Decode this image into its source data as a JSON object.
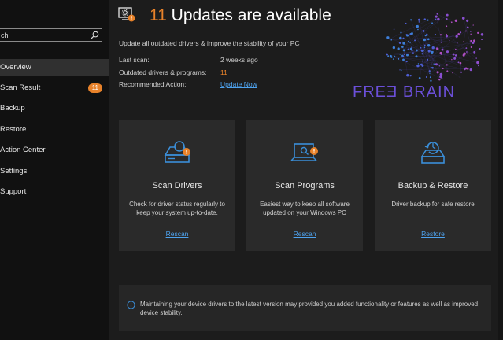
{
  "sidebar": {
    "search_value": "ch",
    "items": [
      {
        "label": "Overview",
        "active": true
      },
      {
        "label": "Scan Result",
        "badge": "11"
      },
      {
        "label": "Backup"
      },
      {
        "label": "Restore"
      },
      {
        "label": "Action Center"
      },
      {
        "label": "Settings"
      },
      {
        "label": "Support"
      }
    ]
  },
  "header": {
    "count": "11",
    "title_rest": " Updates are available",
    "subtitle": "Update all outdated drivers & improve the stability of your PC",
    "last_scan_label": "Last scan:",
    "last_scan_value": "2 weeks ago",
    "outdated_label": "Outdated drivers & programs:",
    "outdated_value": "11",
    "recommended_label": "Recommended Action:",
    "recommended_value": "Update Now"
  },
  "brand": {
    "text": "FREƎ BRAIN",
    "color": "#6b4fd8"
  },
  "cards": [
    {
      "title": "Scan Drivers",
      "desc": "Check for driver status regularly to keep your system up-to-date.",
      "link": "Rescan",
      "icon": "scan-drivers-icon"
    },
    {
      "title": "Scan Programs",
      "desc": "Easiest way to keep all software updated on your Windows PC",
      "link": "Rescan",
      "icon": "scan-programs-icon"
    },
    {
      "title": "Backup & Restore",
      "desc": "Driver backup for safe restore",
      "link": "Restore",
      "icon": "backup-restore-icon"
    }
  ],
  "notice": {
    "text": "Maintaining your device drivers to the latest version may provided you added functionality or features as well as improved device stability."
  },
  "colors": {
    "accent": "#e8822a",
    "link": "#4ea3ef",
    "icon_blue": "#3b8fd9",
    "background": "#1c1c1c",
    "card": "#2a2a2a"
  }
}
